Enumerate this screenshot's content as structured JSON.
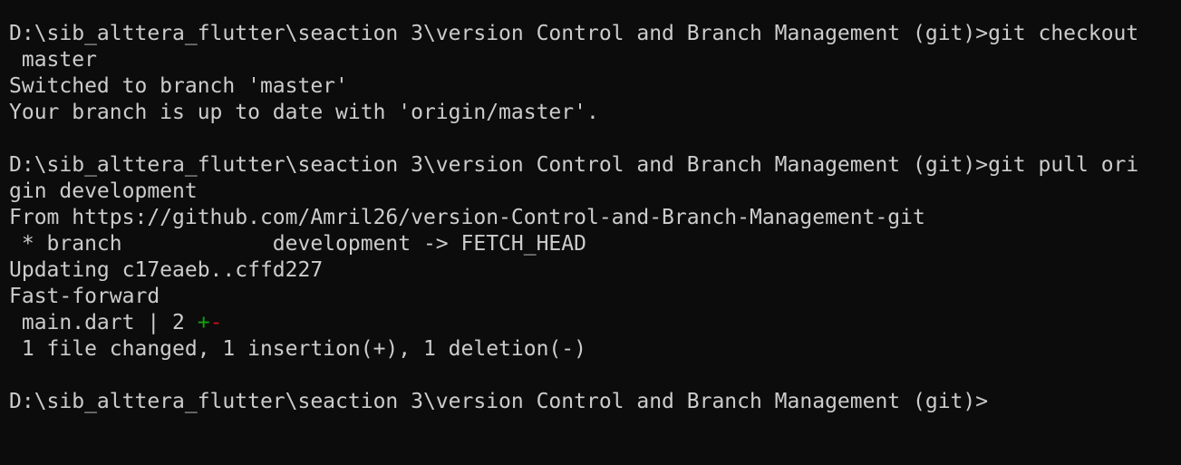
{
  "colors": {
    "background": "#0c0c0c",
    "foreground": "#cccccc",
    "insertion": "#13a10e",
    "deletion": "#c50f1f"
  },
  "terminal": {
    "lines": [
      "D:\\sib_alttera_flutter\\seaction 3\\version Control and Branch Management (git)>git checkout",
      " master",
      "Switched to branch 'master'",
      "Your branch is up to date with 'origin/master'.",
      "",
      "D:\\sib_alttera_flutter\\seaction 3\\version Control and Branch Management (git)>git pull ori",
      "gin development",
      "From https://github.com/Amril26/version-Control-and-Branch-Management-git",
      " * branch            development -> FETCH_HEAD",
      "Updating c17eaeb..cffd227",
      "Fast-forward"
    ],
    "diffstat": {
      "prefix": " main.dart | 2 ",
      "plus": "+",
      "minus": "-"
    },
    "summary": " 1 file changed, 1 insertion(+), 1 deletion(-)",
    "blank": "",
    "prompt": "D:\\sib_alttera_flutter\\seaction 3\\version Control and Branch Management (git)>"
  }
}
